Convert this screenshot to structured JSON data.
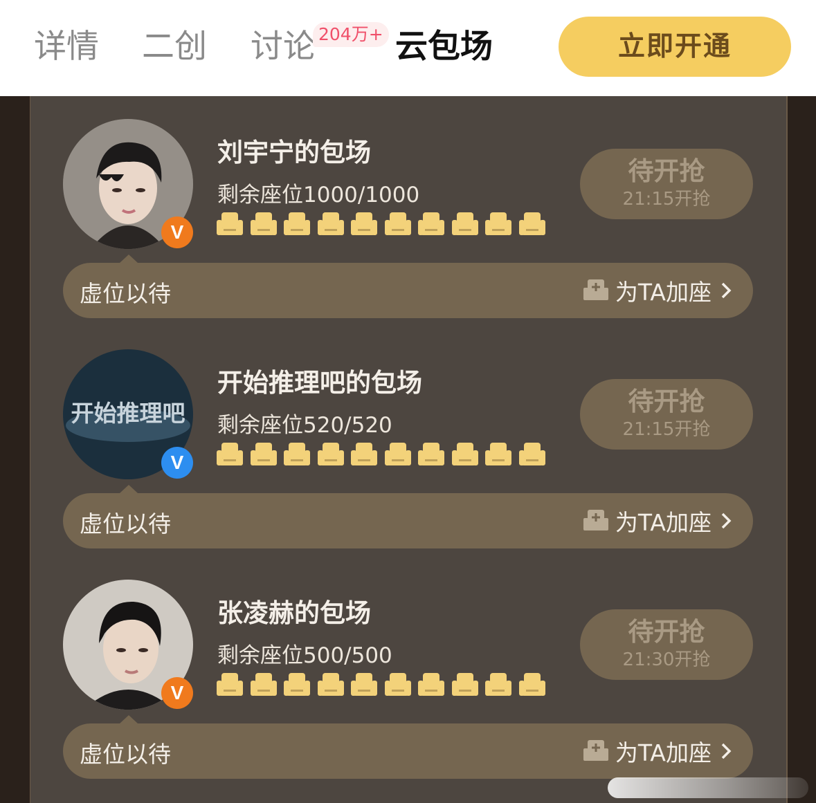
{
  "tabs": [
    {
      "label": "详情",
      "active": false
    },
    {
      "label": "二创",
      "active": false
    },
    {
      "label": "讨论",
      "active": false,
      "badge": "204万+"
    },
    {
      "label": "云包场",
      "active": true
    }
  ],
  "open_button": "立即开通",
  "colors": {
    "accent_yellow": "#f5cd60",
    "panel_bg": "#4d4640",
    "button_bg": "#756650",
    "seat_icon": "#f3d27a"
  },
  "halls": [
    {
      "name": "刘宇宁的包场",
      "seats_label": "剩余座位1000/1000",
      "seats_remaining": 1000,
      "seats_total": 1000,
      "wait_label": "待开抢",
      "open_time": "21:15开抢",
      "verify_badge": "V",
      "verify_color": "orange",
      "avatar": "person-portrait",
      "placeholder_text": "虚位以待",
      "add_seat_label": "为TA加座"
    },
    {
      "name": "开始推理吧的包场",
      "seats_label": "剩余座位520/520",
      "seats_remaining": 520,
      "seats_total": 520,
      "wait_label": "待开抢",
      "open_time": "21:15开抢",
      "verify_badge": "V",
      "verify_color": "blue",
      "avatar": "show-logo",
      "avatar_text": "开始推理吧",
      "placeholder_text": "虚位以待",
      "add_seat_label": "为TA加座"
    },
    {
      "name": "张凌赫的包场",
      "seats_label": "剩余座位500/500",
      "seats_remaining": 500,
      "seats_total": 500,
      "wait_label": "待开抢",
      "open_time": "21:30开抢",
      "verify_badge": "V",
      "verify_color": "orange",
      "avatar": "person-portrait",
      "placeholder_text": "虚位以待",
      "add_seat_label": "为TA加座"
    }
  ],
  "icons": {
    "seat": "armchair-icon",
    "add_seat": "armchair-plus-icon",
    "chevron": "chevron-right-icon"
  }
}
